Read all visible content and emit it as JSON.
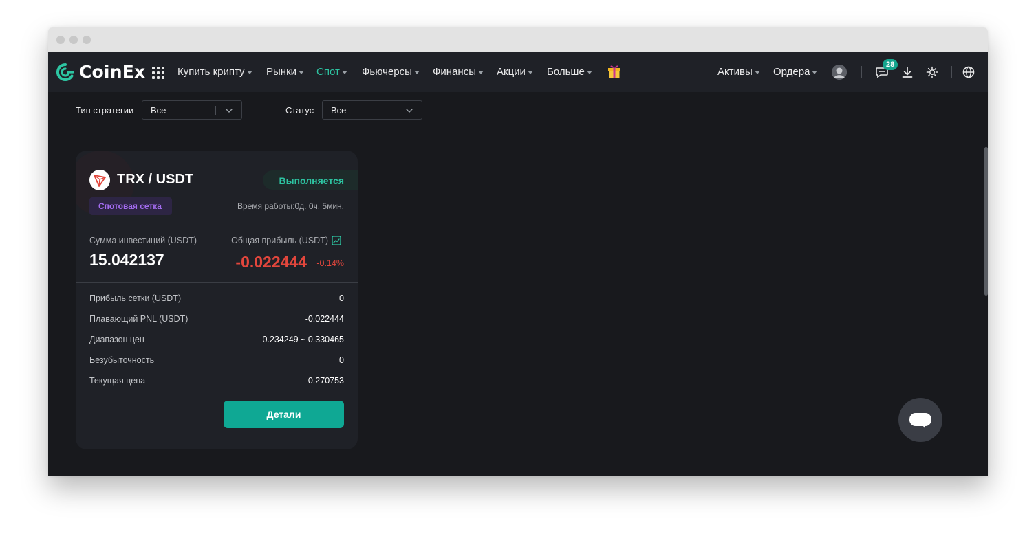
{
  "brand": {
    "name": "CoinEx"
  },
  "nav": {
    "items": [
      {
        "label": "Купить крипту",
        "active": false
      },
      {
        "label": "Рынки",
        "active": false
      },
      {
        "label": "Спот",
        "active": true
      },
      {
        "label": "Фьючерсы",
        "active": false
      },
      {
        "label": "Финансы",
        "active": false
      },
      {
        "label": "Акции",
        "active": false
      },
      {
        "label": "Больше",
        "active": false
      }
    ],
    "right": {
      "assets": "Активы",
      "orders": "Ордера",
      "notifications_count": "28"
    }
  },
  "filters": {
    "strategy_type_label": "Тип стратегии",
    "strategy_type_value": "Все",
    "status_label": "Статус",
    "status_value": "Все"
  },
  "card": {
    "pair": "TRX / USDT",
    "status": "Выполняется",
    "strategy_tag": "Спотовая сетка",
    "runtime": "Время работы:0д. 0ч. 5мин.",
    "investment_label": "Сумма инвестиций (USDT)",
    "investment_value": "15.042137",
    "total_profit_label": "Общая прибыль (USDT)",
    "total_profit_value": "-0.022444",
    "total_profit_pct": "-0.14%",
    "rows": [
      {
        "label": "Прибыль сетки (USDT)",
        "value": "0"
      },
      {
        "label": "Плавающий PNL (USDT)",
        "value": "-0.022444"
      },
      {
        "label": "Диапазон цен",
        "value": "0.234249 ~ 0.330465"
      },
      {
        "label": "Безубыточность",
        "value": "0"
      },
      {
        "label": "Текущая цена",
        "value": "0.270753"
      }
    ],
    "details_button": "Детали"
  },
  "colors": {
    "accent": "#2dc5a2",
    "negative": "#e2463c",
    "tag_purple": "#a36cf0",
    "button": "#0fa894"
  }
}
